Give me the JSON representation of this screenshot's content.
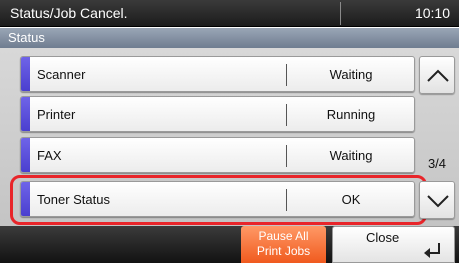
{
  "header": {
    "title": "Status/Job Cancel.",
    "time": "10:10"
  },
  "subheader": {
    "label": "Status"
  },
  "rows": [
    {
      "name": "Scanner",
      "status": "Waiting"
    },
    {
      "name": "Printer",
      "status": "Running"
    },
    {
      "name": "FAX",
      "status": "Waiting"
    },
    {
      "name": "Toner Status",
      "status": "OK"
    }
  ],
  "pager": {
    "page": "3/4",
    "up_icon": "chevron-up-icon",
    "down_icon": "chevron-down-icon"
  },
  "footer": {
    "pause_line1": "Pause All",
    "pause_line2": "Print Jobs",
    "close_label": "Close",
    "close_icon": "enter-return-icon"
  },
  "colors": {
    "accent": "#5a4fdc",
    "highlight": "#e8252a",
    "pause_button": "#f36a2e"
  }
}
